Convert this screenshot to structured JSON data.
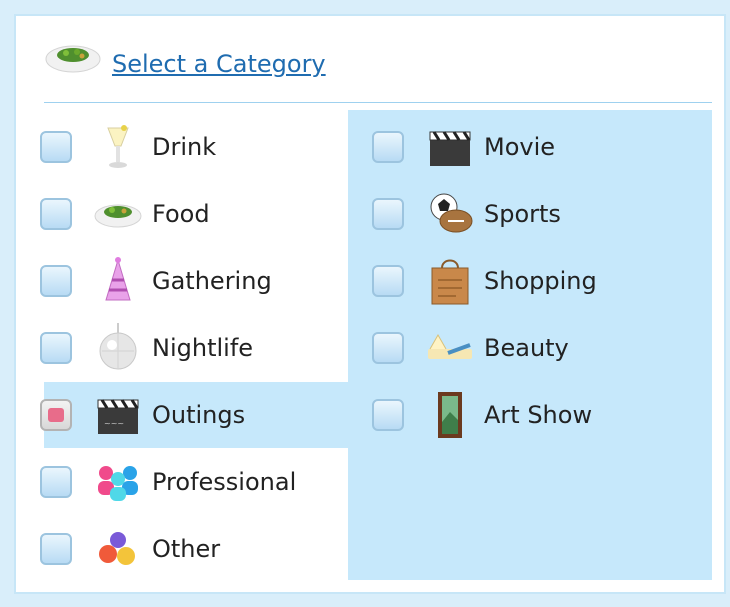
{
  "header": {
    "title": "Select a Category",
    "icon": "food-icon"
  },
  "left_column": [
    {
      "label": "Drink",
      "icon": "drink-icon",
      "checked": false
    },
    {
      "label": "Food",
      "icon": "food-icon",
      "checked": false
    },
    {
      "label": "Gathering",
      "icon": "party-hat-icon",
      "checked": false
    },
    {
      "label": "Nightlife",
      "icon": "disco-ball-icon",
      "checked": false
    },
    {
      "label": "Outings",
      "icon": "clapperboard-icon",
      "checked": true
    },
    {
      "label": "Professional",
      "icon": "people-icon",
      "checked": false
    },
    {
      "label": "Other",
      "icon": "shapes-icon",
      "checked": false
    }
  ],
  "right_column": [
    {
      "label": "Movie",
      "icon": "clapperboard-icon",
      "checked": false
    },
    {
      "label": "Sports",
      "icon": "sports-balls-icon",
      "checked": false
    },
    {
      "label": "Shopping",
      "icon": "shopping-bag-icon",
      "checked": false
    },
    {
      "label": "Beauty",
      "icon": "beauty-icon",
      "checked": false
    },
    {
      "label": "Art Show",
      "icon": "framed-painting-icon",
      "checked": false
    }
  ],
  "colors": {
    "link": "#1f6cb0",
    "selected_row": "#c6e8fb",
    "panel_border": "#c7e6f7",
    "checked_mark": "#e86c8a"
  }
}
